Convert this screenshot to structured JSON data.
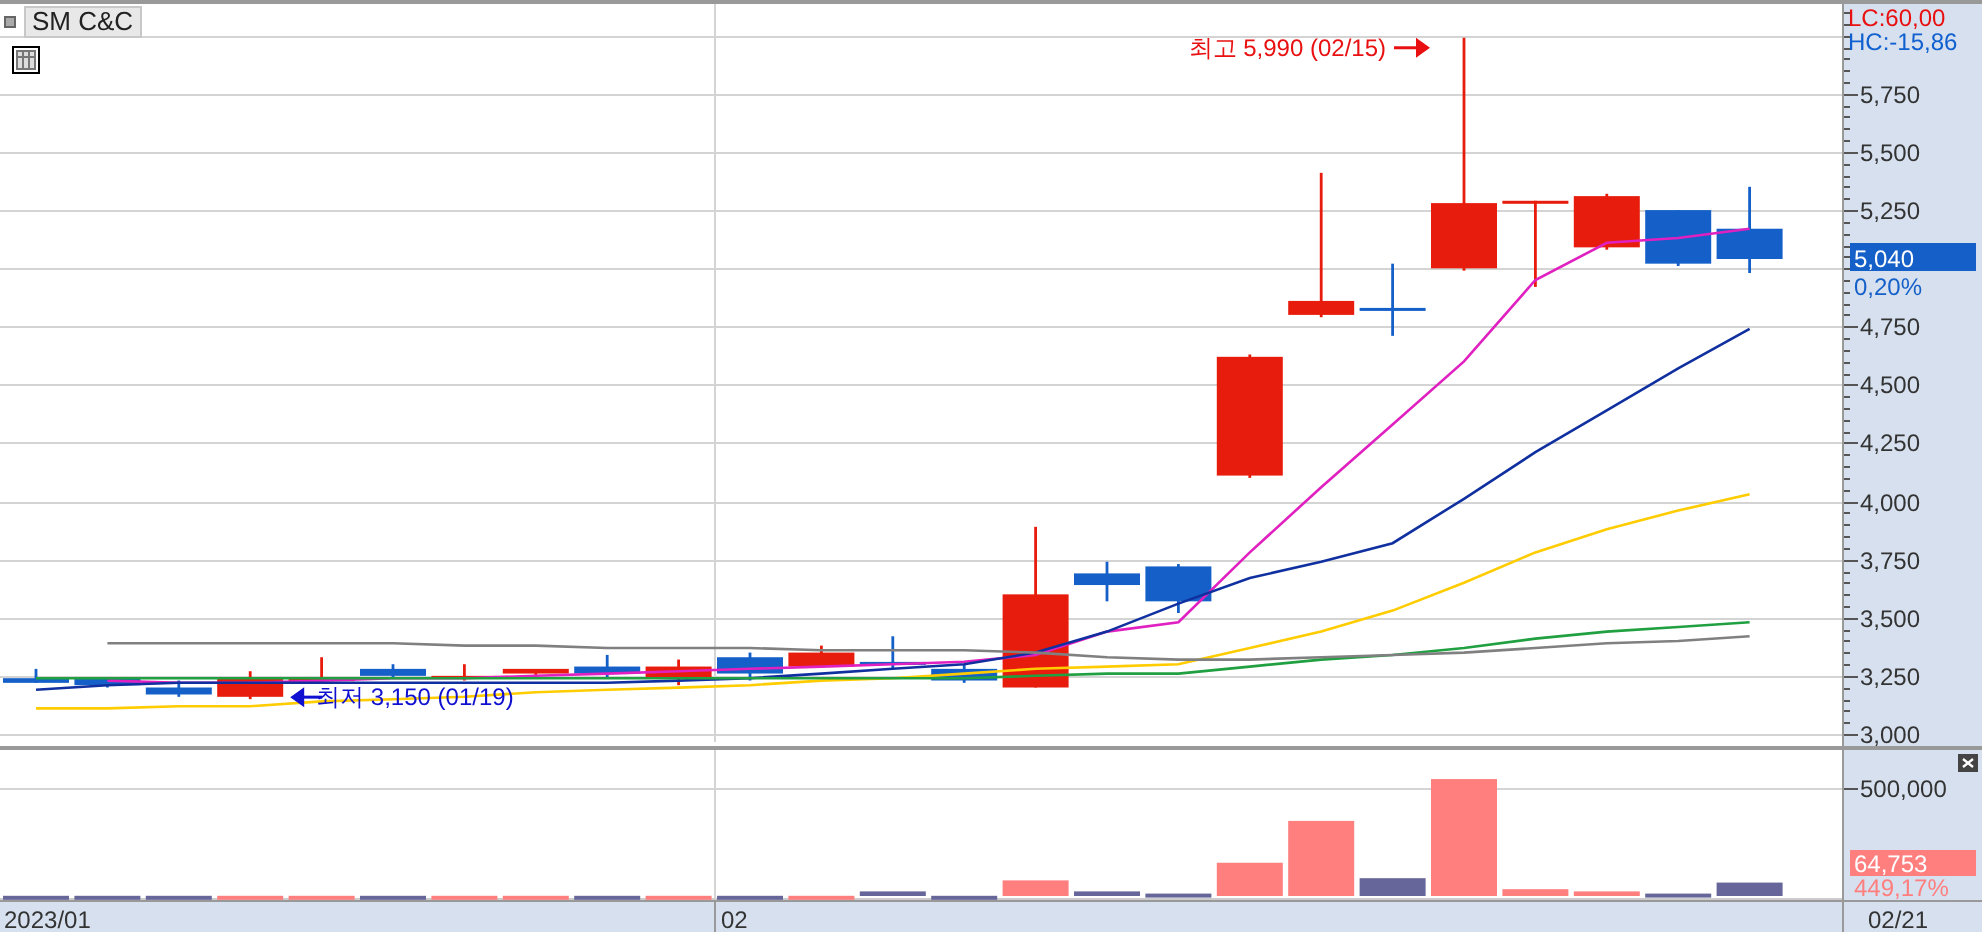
{
  "title": "SM C&C",
  "indicators": [
    {
      "label": "LC:60,00",
      "color": "#e81010"
    },
    {
      "label": "HC:-15,86",
      "color": "#1060d0"
    }
  ],
  "price_panel": {
    "current_price": "5,040",
    "change": "0,20%",
    "high_marker": "최고 5,990 (02/15)",
    "low_marker": "최저 3,150 (01/19)",
    "date_labels": [
      "2023/01",
      "02"
    ],
    "chart_data": {
      "type": "line",
      "ylim": [
        2966,
        6135
      ],
      "grid": true,
      "yticks": [
        {
          "value": 3000,
          "label": "3,000"
        },
        {
          "value": 3250,
          "label": "3,250"
        },
        {
          "value": 3500,
          "label": "3,500"
        },
        {
          "value": 3750,
          "label": "3,750"
        },
        {
          "value": 4000,
          "label": "4,000"
        },
        {
          "value": 4250,
          "label": "4,250"
        },
        {
          "value": 4500,
          "label": "4,500"
        },
        {
          "value": 4750,
          "label": "4,750"
        },
        {
          "value": 5250,
          "label": "5,250"
        },
        {
          "value": 5500,
          "label": "5,500"
        },
        {
          "value": 5750,
          "label": "5,750"
        }
      ],
      "series": [
        {
          "color": "#e020c0",
          "values": [
            null,
            3230,
            3220,
            3220,
            3230,
            3240,
            3240,
            3250,
            3260,
            3270,
            3280,
            3290,
            3300,
            3310,
            3340,
            3440,
            3480,
            3780,
            4060,
            4330,
            4600,
            4950,
            5110,
            5130,
            5170
          ]
        },
        {
          "color": "#1030a0",
          "values": [
            3190,
            3210,
            3220,
            3220,
            3220,
            3220,
            3220,
            3220,
            3220,
            3230,
            3240,
            3260,
            3280,
            3300,
            3350,
            3440,
            3560,
            3670,
            3740,
            3820,
            4010,
            4210,
            4390,
            4570,
            4740
          ]
        },
        {
          "color": "#ffcc00",
          "values": [
            3110,
            3110,
            3120,
            3120,
            3140,
            3150,
            3160,
            3180,
            3190,
            3200,
            3210,
            3230,
            3240,
            3260,
            3280,
            3290,
            3300,
            3370,
            3440,
            3530,
            3650,
            3780,
            3880,
            3960,
            4030
          ]
        },
        {
          "color": "#20a040",
          "values": [
            3240,
            3240,
            3240,
            3240,
            3240,
            3240,
            3240,
            3240,
            3240,
            3240,
            3240,
            3240,
            3240,
            3240,
            3250,
            3260,
            3260,
            3290,
            3320,
            3340,
            3370,
            3410,
            3440,
            3460,
            3480
          ]
        },
        {
          "color": "#808080",
          "values": [
            null,
            3390,
            3390,
            3390,
            3390,
            3390,
            3380,
            3380,
            3370,
            3370,
            3370,
            3360,
            3360,
            3360,
            3350,
            3330,
            3320,
            3320,
            3330,
            3340,
            3350,
            3370,
            3390,
            3400,
            3420
          ]
        }
      ]
    }
  },
  "volume_panel": {
    "current_volume": "64,753",
    "change": "449,17%",
    "axis_label": "500,000"
  },
  "current_date": "02/21"
}
